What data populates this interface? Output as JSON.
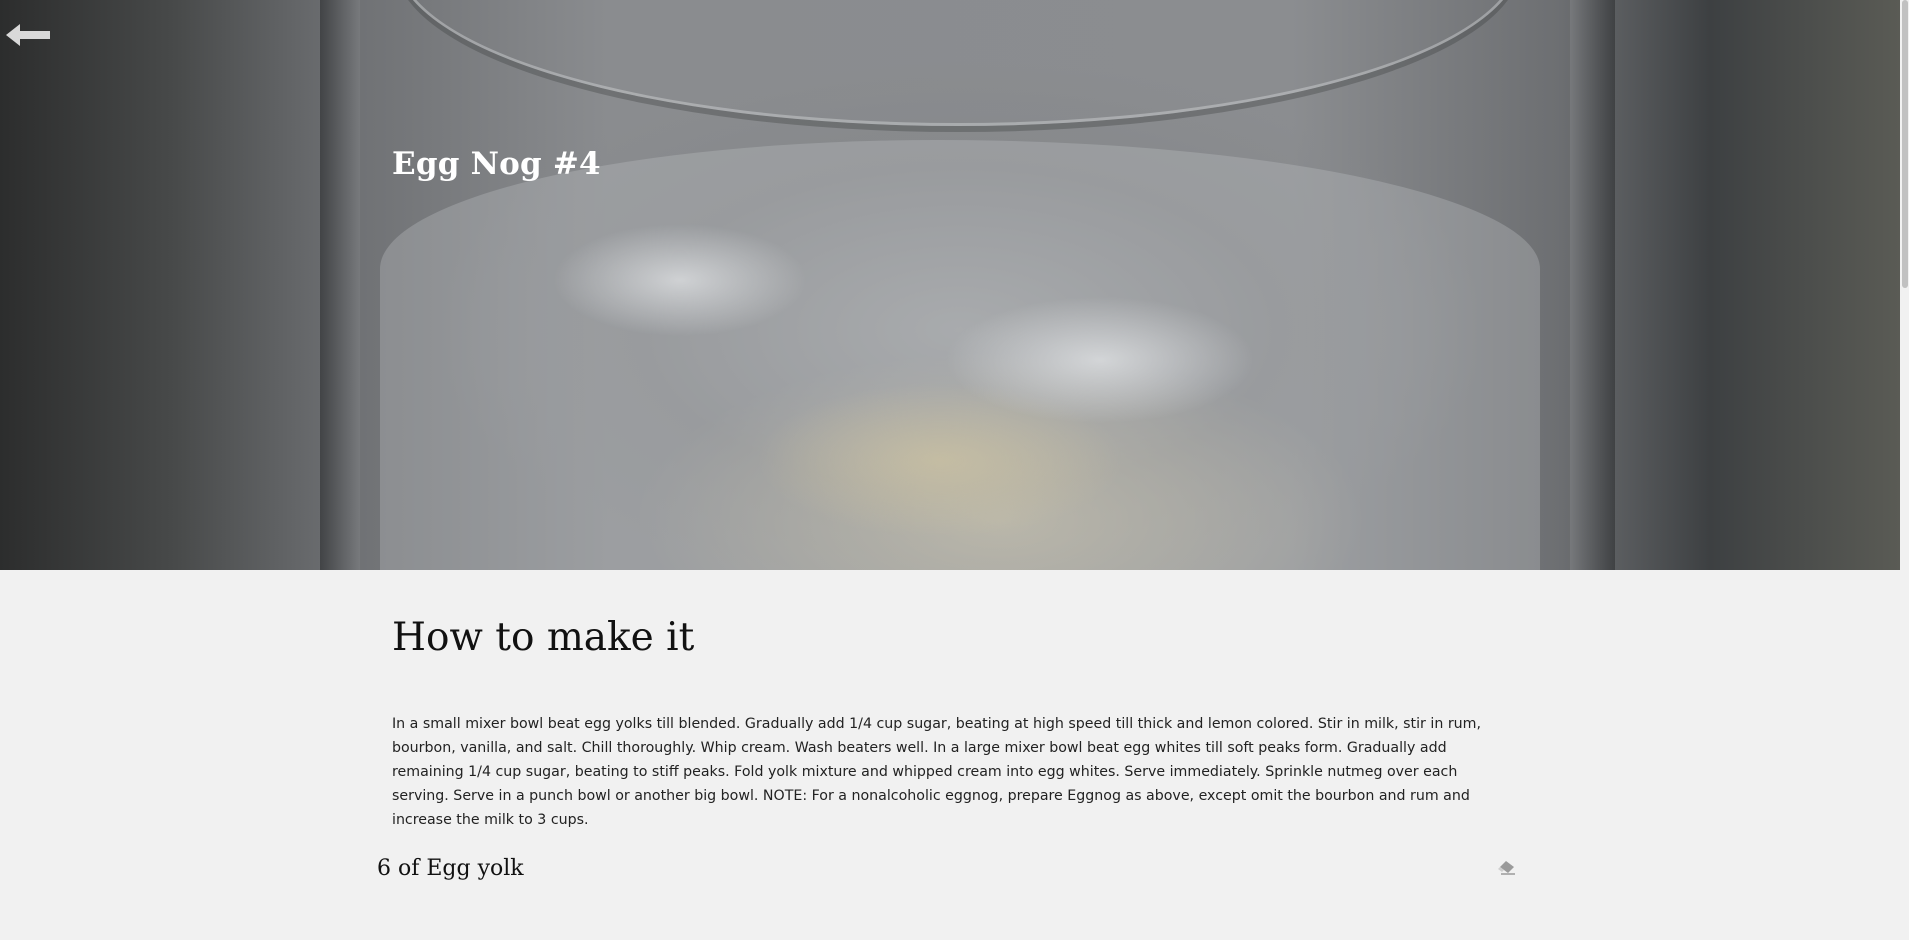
{
  "hero": {
    "title": "Egg Nog #4",
    "back_icon": "arrow-left-icon"
  },
  "main": {
    "heading": "How to make it",
    "instructions": "In a small mixer bowl beat egg yolks till blended. Gradually add 1/4 cup sugar, beating at high speed till thick and lemon colored. Stir in milk, stir in rum, bourbon, vanilla, and salt. Chill thoroughly. Whip cream. Wash beaters well. In a large mixer bowl beat egg whites till soft peaks form. Gradually add remaining 1/4 cup sugar, beating to stiff peaks. Fold yolk mixture and whipped cream into egg whites. Serve immediately. Sprinkle nutmeg over each serving. Serve in a punch bowl or another big bowl. NOTE: For a nonalcoholic eggnog, prepare Eggnog as above, except omit the bourbon and rum and increase the milk to 3 cups.",
    "ingredients": [
      {
        "label": "6 of Egg yolk",
        "action_icon": "eraser-icon"
      }
    ]
  },
  "colors": {
    "page_background": "#f1f1f1",
    "hero_title": "#ffffff",
    "heading_text": "#111111"
  }
}
